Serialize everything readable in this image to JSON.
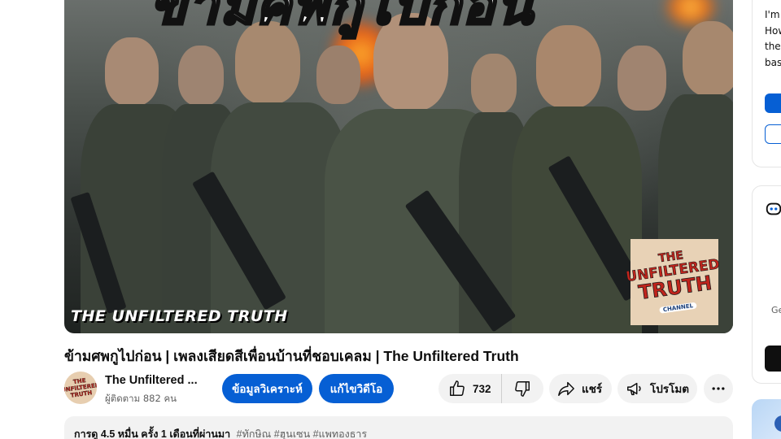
{
  "video": {
    "thumbnail_title": "ข้ามศพกูไปก่อน",
    "thumbnail_watermark": "THE UNFILTERED TRUTH",
    "logo_lines": [
      "THE",
      "UNFILTERED",
      "TRUTH",
      "CHANNEL"
    ],
    "title": "ข้ามศพกูไปก่อน | เพลงเสียดสีเพื่อนบ้านที่ชอบเคลม | The Unfiltered Truth"
  },
  "channel": {
    "name": "The Unfiltered ...",
    "subscribers": "ผู้ติดตาม 882 คน",
    "avatar_text": "THE UNFILTERED TRUTH"
  },
  "actions": {
    "analysis_label": "ข้อมูลวิเคราะห์",
    "edit_label": "แก้ไขวิดีโอ",
    "like_count": "732",
    "share_label": "แชร์",
    "promote_label": "โปรโมต"
  },
  "description": {
    "meta": "การดู 4.5 หมื่น ครั้ง  1 เดือนที่ผ่านมา",
    "tags": "#ทักษิณ #ฮุนเซน #แพทองธาร"
  },
  "sidebar": {
    "card1_lines": [
      "I'm",
      "How",
      "the",
      "bas"
    ],
    "card2_text": "Ge"
  },
  "colors": {
    "accent": "#065fd4",
    "text": "#0f0f0f",
    "secondary_text": "#606060",
    "chip_bg": "#f2f2f2"
  }
}
